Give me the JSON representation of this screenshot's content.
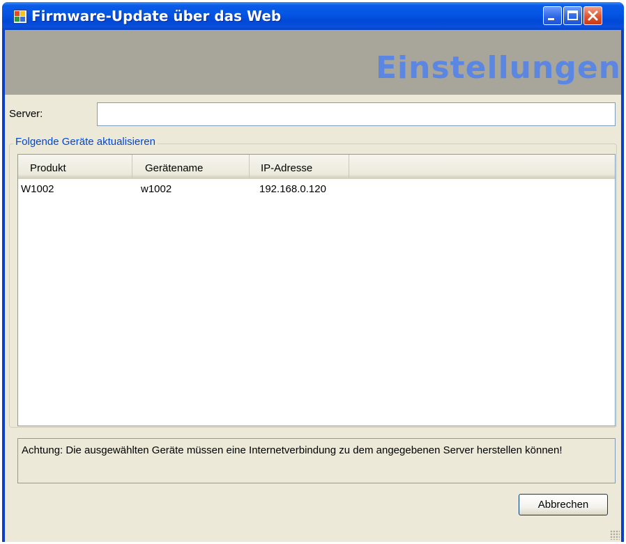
{
  "window": {
    "title": "Firmware-Update über das Web"
  },
  "banner": {
    "title": "Einstellungen"
  },
  "server": {
    "label": "Server:",
    "value": ""
  },
  "devices": {
    "group_label": "Folgende Geräte aktualisieren",
    "columns": [
      "Produkt",
      "Gerätename",
      "IP-Adresse"
    ],
    "rows": [
      [
        "W1002",
        "w1002",
        "192.168.0.120"
      ]
    ]
  },
  "notice": {
    "text": "Achtung: Die ausgewählten Geräte müssen eine Internetverbindung zu dem angegebenen Server herstellen können!"
  },
  "buttons": {
    "cancel_label": "Abbrechen"
  },
  "colors": {
    "titlebar": "#0054e3",
    "banner_bg": "#a8a59a",
    "banner_text": "#5b87e3",
    "dialog_bg": "#ece9d8",
    "group_label": "#0046d5"
  }
}
